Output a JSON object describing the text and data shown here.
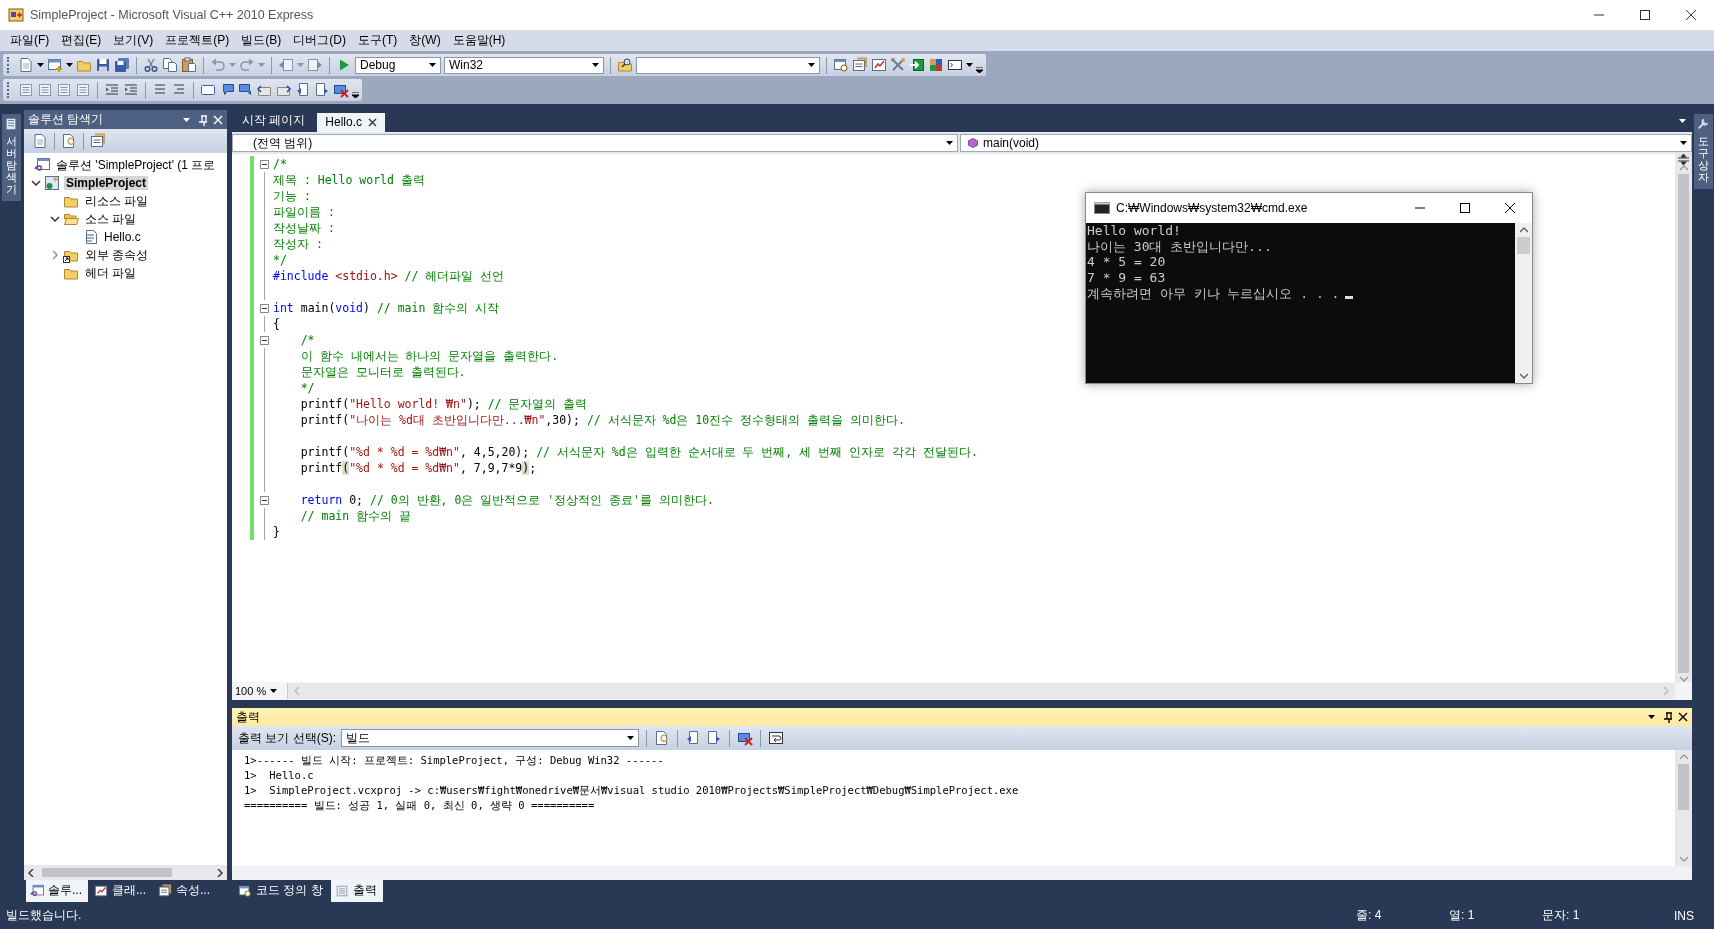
{
  "window": {
    "title": "SimpleProject - Microsoft Visual C++ 2010 Express"
  },
  "menu": [
    "파일(F)",
    "편집(E)",
    "보기(V)",
    "프로젝트(P)",
    "빌드(B)",
    "디버그(D)",
    "도구(T)",
    "창(W)",
    "도움말(H)"
  ],
  "toolbar": {
    "configuration": "Debug",
    "platform": "Win32"
  },
  "side_tabs": {
    "left": "서버 탐색기",
    "right": "도구 상자"
  },
  "solution_explorer": {
    "title": "솔루션 탐색기",
    "tree": [
      {
        "label": "솔루션 'SimpleProject' (1 프로",
        "kind": "solution",
        "selected": false,
        "children": [
          {
            "label": "SimpleProject",
            "kind": "project",
            "selected": true,
            "expanded": true,
            "children": [
              {
                "label": "리소스 파일",
                "kind": "folder",
                "selected": false
              },
              {
                "label": "소스 파일",
                "kind": "folder",
                "selected": false,
                "expanded": true,
                "children": [
                  {
                    "label": "Hello.c",
                    "kind": "file",
                    "selected": false
                  }
                ]
              },
              {
                "label": "외부 종속성",
                "kind": "shortcut",
                "selected": false,
                "expanded": false
              },
              {
                "label": "헤더 파일",
                "kind": "folder",
                "selected": false
              }
            ]
          }
        ]
      }
    ]
  },
  "editor": {
    "tabs": [
      {
        "label": "시작 페이지",
        "selected": false
      },
      {
        "label": "Hello.c",
        "selected": true
      }
    ],
    "scope": "(전역 범위)",
    "member": "main(void)",
    "zoom": "100 %",
    "lines": [
      {
        "fold": true,
        "segments": [
          {
            "kind": "comment",
            "text": "/*"
          }
        ]
      },
      {
        "fold": false,
        "segments": [
          {
            "kind": "comment",
            "text": "제목 : Hello world 출력"
          }
        ]
      },
      {
        "fold": false,
        "segments": [
          {
            "kind": "comment",
            "text": "기능 :"
          }
        ]
      },
      {
        "fold": false,
        "segments": [
          {
            "kind": "comment",
            "text": "파일이름 :"
          }
        ]
      },
      {
        "fold": false,
        "segments": [
          {
            "kind": "comment",
            "text": "작성날짜 :"
          }
        ]
      },
      {
        "fold": false,
        "segments": [
          {
            "kind": "comment",
            "text": "작성자 :"
          }
        ]
      },
      {
        "fold": false,
        "segments": [
          {
            "kind": "comment",
            "text": "*/"
          }
        ]
      },
      {
        "fold": false,
        "segments": [
          {
            "kind": "keyword",
            "text": "#include"
          },
          {
            "kind": "string",
            "text": " <stdio.h>"
          },
          {
            "kind": "comment",
            "text": " // 헤더파일 선언"
          }
        ]
      },
      {
        "fold": false
      },
      {
        "fold": true,
        "segments": [
          {
            "kind": "keyword",
            "text": "int"
          },
          {
            "kind": "plain",
            "text": " main("
          },
          {
            "kind": "keyword",
            "text": "void"
          },
          {
            "kind": "plain",
            "text": ") "
          },
          {
            "kind": "comment",
            "text": "// main 함수의 시작"
          }
        ]
      },
      {
        "fold": false,
        "segments": [
          {
            "kind": "plain",
            "text": "{"
          }
        ]
      },
      {
        "fold": true,
        "segments": [
          {
            "kind": "comment",
            "text": "    /*"
          }
        ]
      },
      {
        "fold": false,
        "segments": [
          {
            "kind": "comment",
            "text": "    이 함수 내에서는 하나의 문자열을 출력한다."
          }
        ]
      },
      {
        "fold": false,
        "segments": [
          {
            "kind": "comment",
            "text": "    문자열은 모니터로 출력된다."
          }
        ]
      },
      {
        "fold": false,
        "segments": [
          {
            "kind": "comment",
            "text": "    */"
          }
        ]
      },
      {
        "fold": false,
        "segments": [
          {
            "kind": "plain",
            "text": "    printf("
          },
          {
            "kind": "string",
            "text": "\"Hello world! ₩n\""
          },
          {
            "kind": "plain",
            "text": "); "
          },
          {
            "kind": "comment",
            "text": "// 문자열의 출력"
          }
        ]
      },
      {
        "fold": false,
        "segments": [
          {
            "kind": "plain",
            "text": "    printf("
          },
          {
            "kind": "string",
            "text": "\"나이는 %d대 초반입니다만...₩n\""
          },
          {
            "kind": "plain",
            "text": ",30); "
          },
          {
            "kind": "comment",
            "text": "// 서식문자 %d은 10진수 정수형태의 출력을 의미한다."
          }
        ]
      },
      {
        "fold": false
      },
      {
        "fold": false,
        "segments": [
          {
            "kind": "plain",
            "text": "    printf("
          },
          {
            "kind": "string",
            "text": "\"%d * %d = %d₩n\""
          },
          {
            "kind": "plain",
            "text": ", 4,5,20); "
          },
          {
            "kind": "comment",
            "text": "// 서식문자 %d은 입력한 순서대로 두 번째, 세 번째 인자로 각각 전달된다."
          }
        ]
      },
      {
        "fold": false,
        "segments": [
          {
            "kind": "plain",
            "text": "    printf"
          },
          {
            "kind": "match",
            "text": "("
          },
          {
            "kind": "string",
            "text": "\"%d * %d = %d₩n\""
          },
          {
            "kind": "plain",
            "text": ", 7,9,7*9"
          },
          {
            "kind": "match",
            "text": ")"
          },
          {
            "kind": "plain",
            "text": ";"
          }
        ]
      },
      {
        "fold": false
      },
      {
        "fold": true,
        "segments": [
          {
            "kind": "keyword",
            "text": "    return"
          },
          {
            "kind": "plain",
            "text": " 0; "
          },
          {
            "kind": "comment",
            "text": "// 0의 반환, 0은 일반적으로 '정상적인 종료'를 의미한다."
          }
        ]
      },
      {
        "fold": false,
        "segments": [
          {
            "kind": "comment",
            "text": "    // main 함수의 끝"
          }
        ]
      },
      {
        "fold": false,
        "segments": [
          {
            "kind": "plain",
            "text": "}"
          }
        ]
      }
    ]
  },
  "console": {
    "title": "C:₩Windows₩system32₩cmd.exe",
    "lines": [
      "Hello world!",
      "나이는 30대 초반입니다만...",
      "4 * 5 = 20",
      "7 * 9 = 63",
      "계속하려면 아무 키나 누르십시오 . . ."
    ]
  },
  "output": {
    "title": "출력",
    "source_label": "출력 보기 선택(S):",
    "source": "빌드",
    "lines": [
      "1>------ 빌드 시작: 프로젝트: SimpleProject, 구성: Debug Win32 ------",
      "1>  Hello.c",
      "1>  SimpleProject.vcxproj -> c:₩users₩fight₩onedrive₩문서₩visual studio 2010₩Projects₩SimpleProject₩Debug₩SimpleProject.exe",
      "========== 빌드: 성공 1, 실패 0, 최신 0, 생략 0 =========="
    ]
  },
  "bottom_tabs": {
    "left": [
      {
        "label": "솔루...",
        "selected": true
      },
      {
        "label": "클래...",
        "selected": false
      },
      {
        "label": "속성...",
        "selected": false
      }
    ],
    "right": [
      {
        "label": "코드 정의 창",
        "selected": false
      },
      {
        "label": "출력",
        "selected": true
      }
    ]
  },
  "status_bar": {
    "message": "빌드했습니다.",
    "line": "줄: 4",
    "column": "열: 1",
    "char": "문자: 1",
    "mode": "INS"
  }
}
